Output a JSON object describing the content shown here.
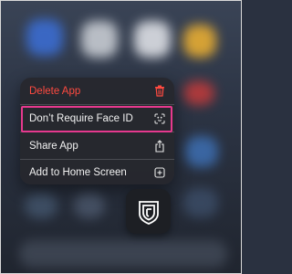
{
  "menu": {
    "items": [
      {
        "label": "Delete App",
        "icon": "trash-icon",
        "destructive": true
      },
      {
        "label": "Don’t Require Face ID",
        "icon": "face-id-icon",
        "highlighted": true
      },
      {
        "label": "Share App",
        "icon": "share-icon"
      },
      {
        "label": "Add to Home Screen",
        "icon": "add-square-icon"
      }
    ]
  },
  "app": {
    "icon": "app-shield-icon"
  },
  "colors": {
    "destructive": "#ff4a40",
    "highlight_border": "#e6398e",
    "menu_bg": "#26282e"
  }
}
